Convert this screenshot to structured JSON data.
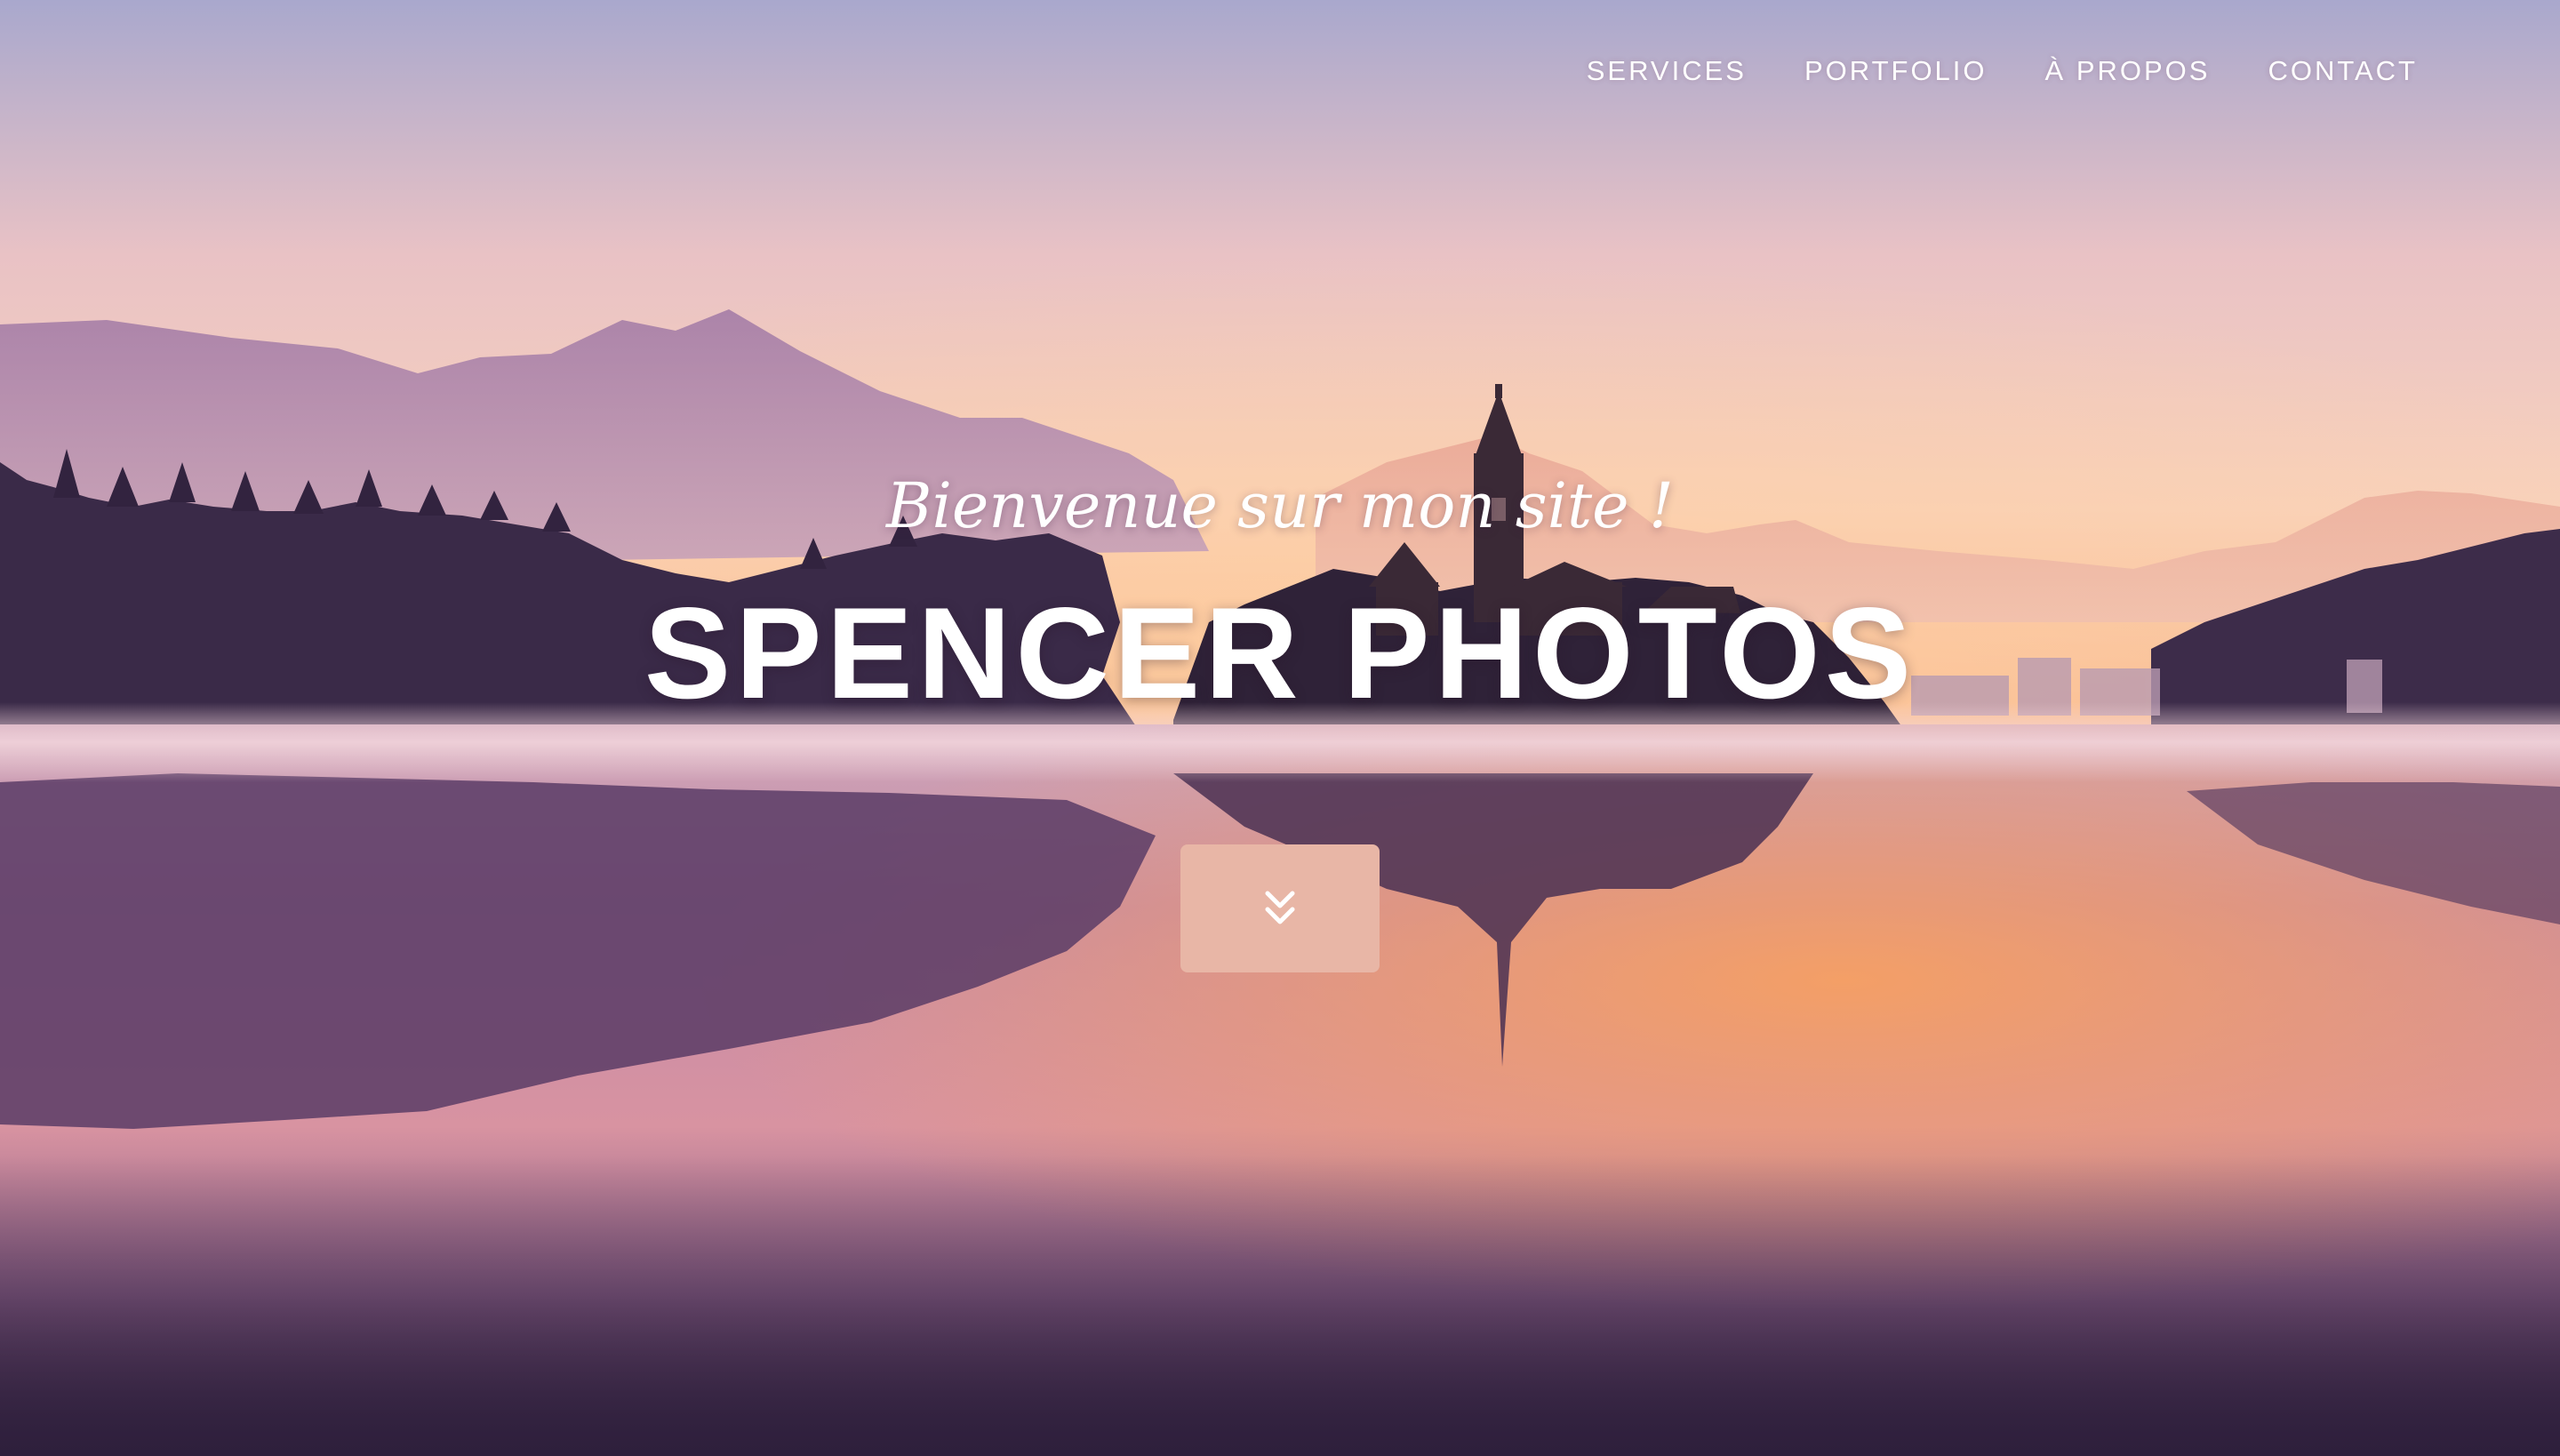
{
  "nav": {
    "items": [
      {
        "label": "SERVICES"
      },
      {
        "label": "PORTFOLIO"
      },
      {
        "label": "À PROPOS"
      },
      {
        "label": "CONTACT"
      }
    ]
  },
  "hero": {
    "welcome": "Bienvenue sur mon site !",
    "title": "SPENCER PHOTOS",
    "background": "sunrise-lake-with-island-church",
    "scroll_button": {
      "icon": "double-chevron-down-icon",
      "color": "#e8b6a6"
    }
  },
  "colors": {
    "sky_top": "#a9a8cd",
    "sky_glow": "#f6b489",
    "water_orange": "#f29e64",
    "water_dark": "#2e1f3c",
    "text": "#ffffff"
  }
}
